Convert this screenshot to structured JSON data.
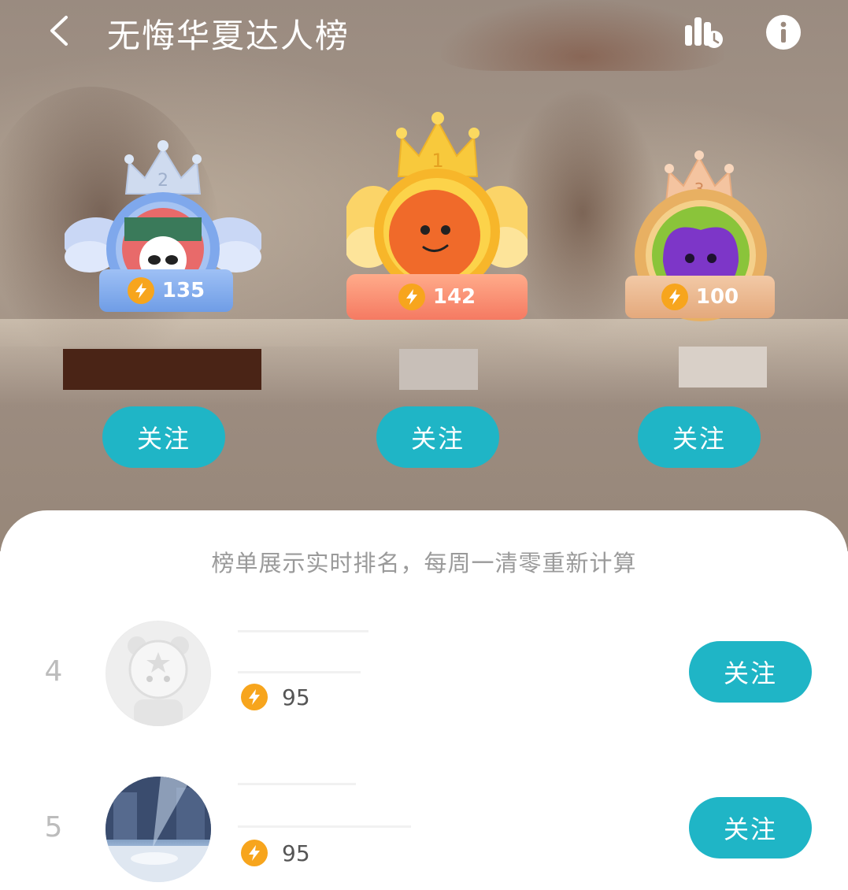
{
  "header": {
    "title": "无悔华夏达人榜",
    "back_icon": "chevron-left-icon",
    "stats_icon": "stats-clock-icon",
    "info_icon": "info-icon"
  },
  "podium": [
    {
      "rank": "1",
      "score": "142",
      "follow_label": "关注",
      "tier_color": "#f7b62a"
    },
    {
      "rank": "2",
      "score": "135",
      "follow_label": "关注",
      "tier_color": "#8fb4ee"
    },
    {
      "rank": "3",
      "score": "100",
      "follow_label": "关注",
      "tier_color": "#e8b58a"
    }
  ],
  "notice": "榜单展示实时排名，每周一清零重新计算",
  "list": [
    {
      "rank": "4",
      "score": "95",
      "follow_label": "关注"
    },
    {
      "rank": "5",
      "score": "95",
      "follow_label": "关注"
    }
  ],
  "colors": {
    "accent": "#1fb5c6",
    "bolt": "#f7a51d"
  }
}
